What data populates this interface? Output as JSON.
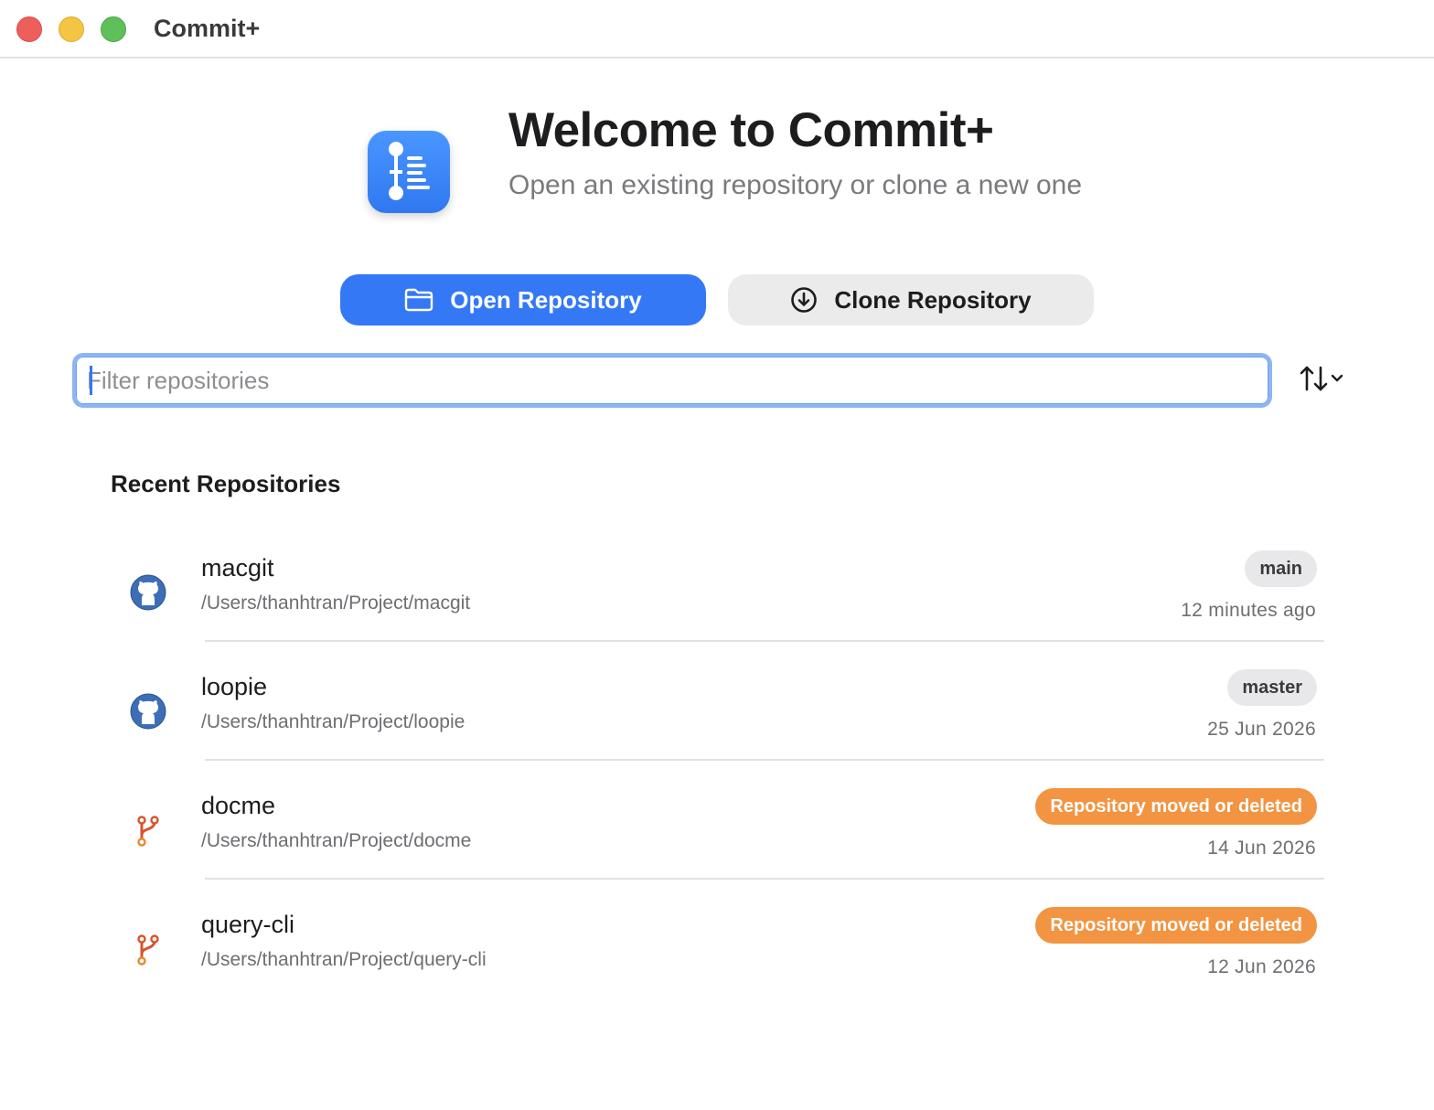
{
  "window": {
    "title": "Commit+"
  },
  "header": {
    "title": "Welcome to Commit+",
    "subtitle": "Open an existing repository or clone a new one"
  },
  "actions": {
    "open_label": "Open Repository",
    "clone_label": "Clone Repository"
  },
  "filter": {
    "placeholder": "Filter repositories",
    "value": ""
  },
  "recent": {
    "title": "Recent Repositories",
    "repos": [
      {
        "name": "macgit",
        "path": "/Users/thanhtran/Project/macgit",
        "badge": "main",
        "badge_kind": "branch",
        "date": "12 minutes ago",
        "icon": "github-icon"
      },
      {
        "name": "loopie",
        "path": "/Users/thanhtran/Project/loopie",
        "badge": "master",
        "badge_kind": "branch",
        "date": "25 Jun 2026",
        "icon": "github-icon"
      },
      {
        "name": "docme",
        "path": "/Users/thanhtran/Project/docme",
        "badge": "Repository moved or deleted",
        "badge_kind": "warning",
        "date": "14 Jun 2026",
        "icon": "git-branch-icon"
      },
      {
        "name": "query-cli",
        "path": "/Users/thanhtran/Project/query-cli",
        "badge": "Repository moved or deleted",
        "badge_kind": "warning",
        "date": "12 Jun 2026",
        "icon": "git-branch-icon"
      }
    ]
  },
  "colors": {
    "accent": "#3478f6",
    "warning": "#f29441",
    "branch_badge": "#e8e8ea"
  }
}
